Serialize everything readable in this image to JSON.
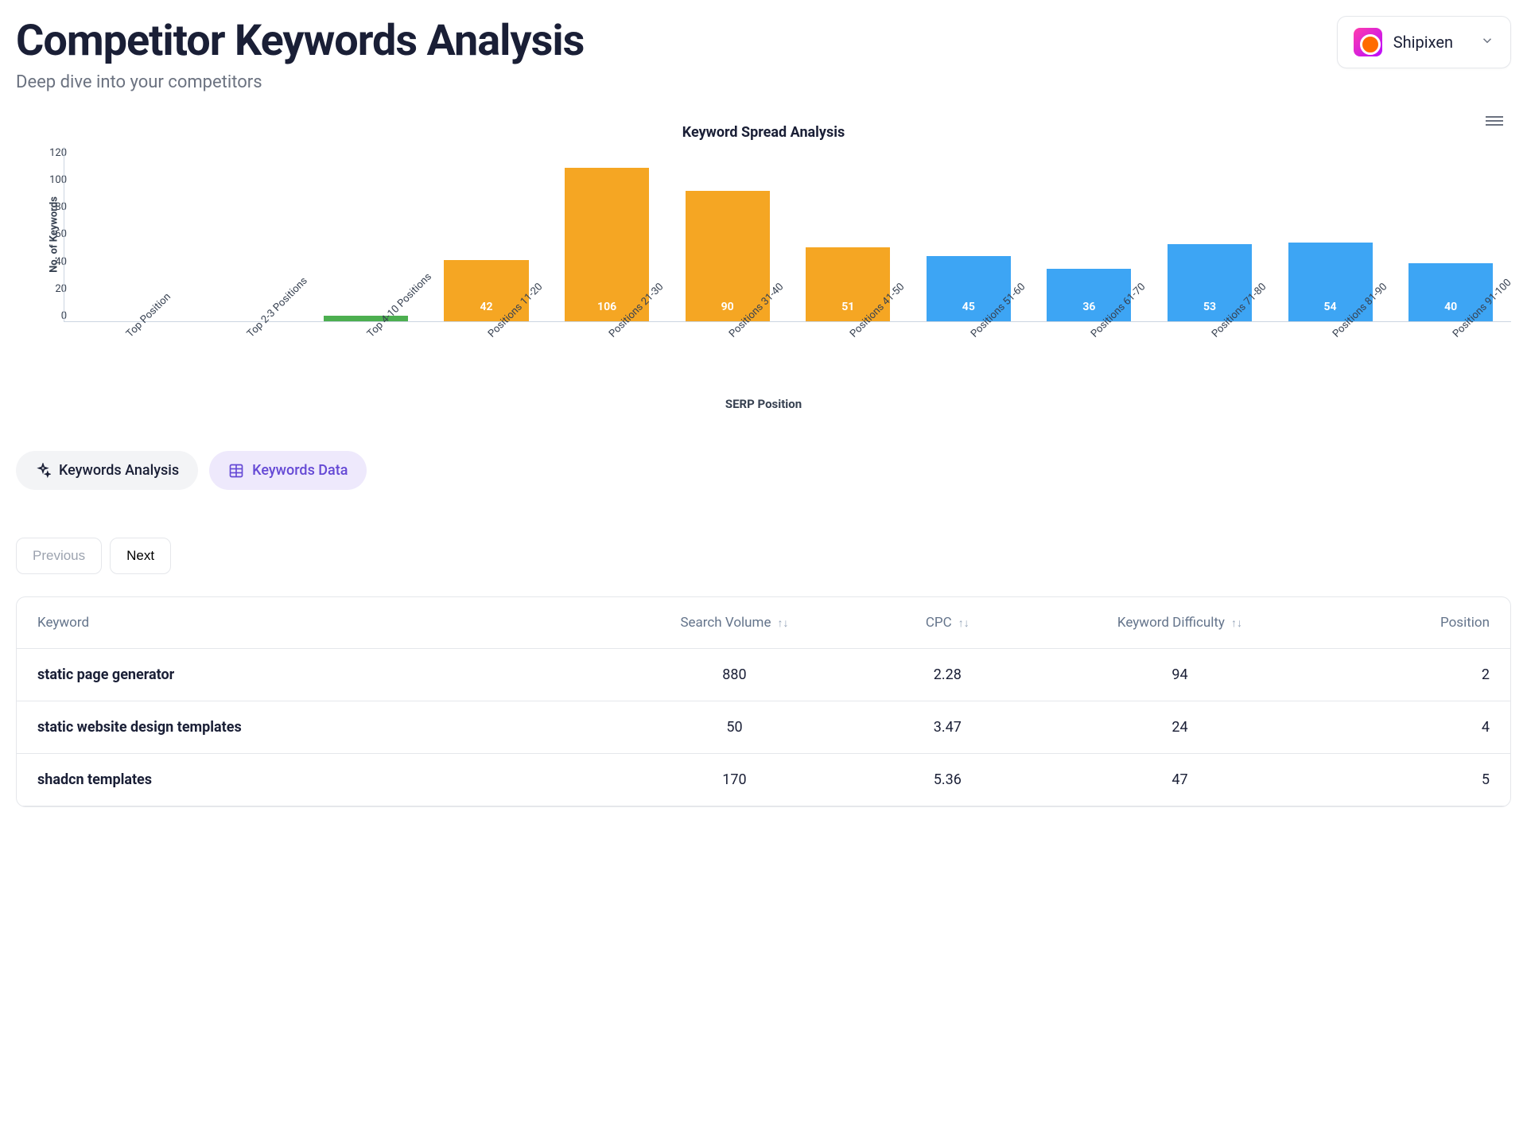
{
  "header": {
    "title": "Competitor Keywords Analysis",
    "subtitle": "Deep dive into your competitors",
    "competitor_name": "Shipixen"
  },
  "tabs": {
    "analysis": "Keywords Analysis",
    "data": "Keywords Data"
  },
  "pagination": {
    "previous": "Previous",
    "next": "Next"
  },
  "table": {
    "headers": {
      "keyword": "Keyword",
      "volume": "Search Volume",
      "cpc": "CPC",
      "difficulty": "Keyword Difficulty",
      "position": "Position"
    },
    "rows": [
      {
        "keyword": "static page generator",
        "volume": "880",
        "cpc": "2.28",
        "difficulty": "94",
        "position": "2"
      },
      {
        "keyword": "static website design templates",
        "volume": "50",
        "cpc": "3.47",
        "difficulty": "24",
        "position": "4"
      },
      {
        "keyword": "shadcn templates",
        "volume": "170",
        "cpc": "5.36",
        "difficulty": "47",
        "position": "5"
      }
    ]
  },
  "chart_data": {
    "type": "bar",
    "title": "Keyword Spread Analysis",
    "xlabel": "SERP Position",
    "ylabel": "No. of Keywords",
    "ylim": [
      0,
      120
    ],
    "yticks": [
      120,
      100,
      80,
      60,
      40,
      20,
      0
    ],
    "categories": [
      "Top Position",
      "Top 2-3 Positions",
      "Top 4-10 Positions",
      "Positions 11-20",
      "Positions 21-30",
      "Positions 31-40",
      "Positions 41-50",
      "Positions 51-60",
      "Positions 61-70",
      "Positions 71-80",
      "Positions 81-90",
      "Positions 91-100"
    ],
    "values": [
      0,
      0,
      4,
      42,
      106,
      90,
      51,
      45,
      36,
      53,
      54,
      40
    ],
    "colors": [
      "#4caf50",
      "#4caf50",
      "#4caf50",
      "#f5a623",
      "#f5a623",
      "#f5a623",
      "#f5a623",
      "#3da5f4",
      "#3da5f4",
      "#3da5f4",
      "#3da5f4",
      "#3da5f4"
    ]
  }
}
